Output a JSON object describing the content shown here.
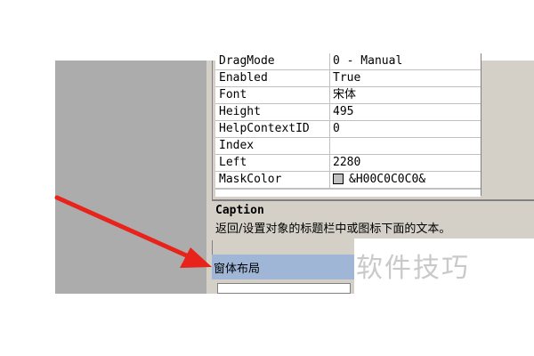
{
  "properties": {
    "rows": [
      {
        "name": "DragMode",
        "value": "0 - Manual"
      },
      {
        "name": "Enabled",
        "value": "True"
      },
      {
        "name": "Font",
        "value": "宋体"
      },
      {
        "name": "Height",
        "value": "495"
      },
      {
        "name": "HelpContextID",
        "value": "0"
      },
      {
        "name": "Index",
        "value": ""
      },
      {
        "name": "Left",
        "value": "2280"
      },
      {
        "name": "MaskColor",
        "value": "&H00C0C0C0&"
      }
    ]
  },
  "description": {
    "title": "Caption",
    "text": "返回/设置对象的标题栏中或图标下面的文本。"
  },
  "form_layout": {
    "title": "窗体布局"
  },
  "watermark": {
    "text": "软件技巧"
  },
  "colors": {
    "arrow": "#e8231b",
    "layout_bar": "#9fb6d6",
    "pane": "#d4d0c8"
  }
}
